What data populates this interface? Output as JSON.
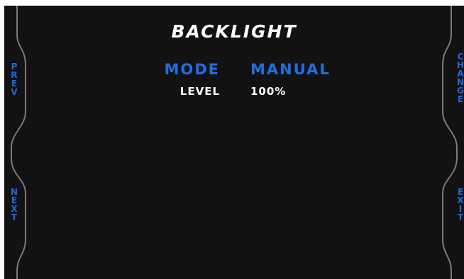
{
  "screen": {
    "title": "BACKLIGHT",
    "rows": [
      {
        "label": "MODE",
        "value": "MANUAL"
      },
      {
        "label": "LEVEL",
        "value": "100%"
      }
    ]
  },
  "soft_keys": {
    "left_top": "PREV",
    "left_bottom": "NEXT",
    "right_top": "CHANGE",
    "right_bottom": "EXIT"
  },
  "colors": {
    "background": "#121212",
    "accent": "#1f6fe0",
    "text": "#ffffff"
  }
}
